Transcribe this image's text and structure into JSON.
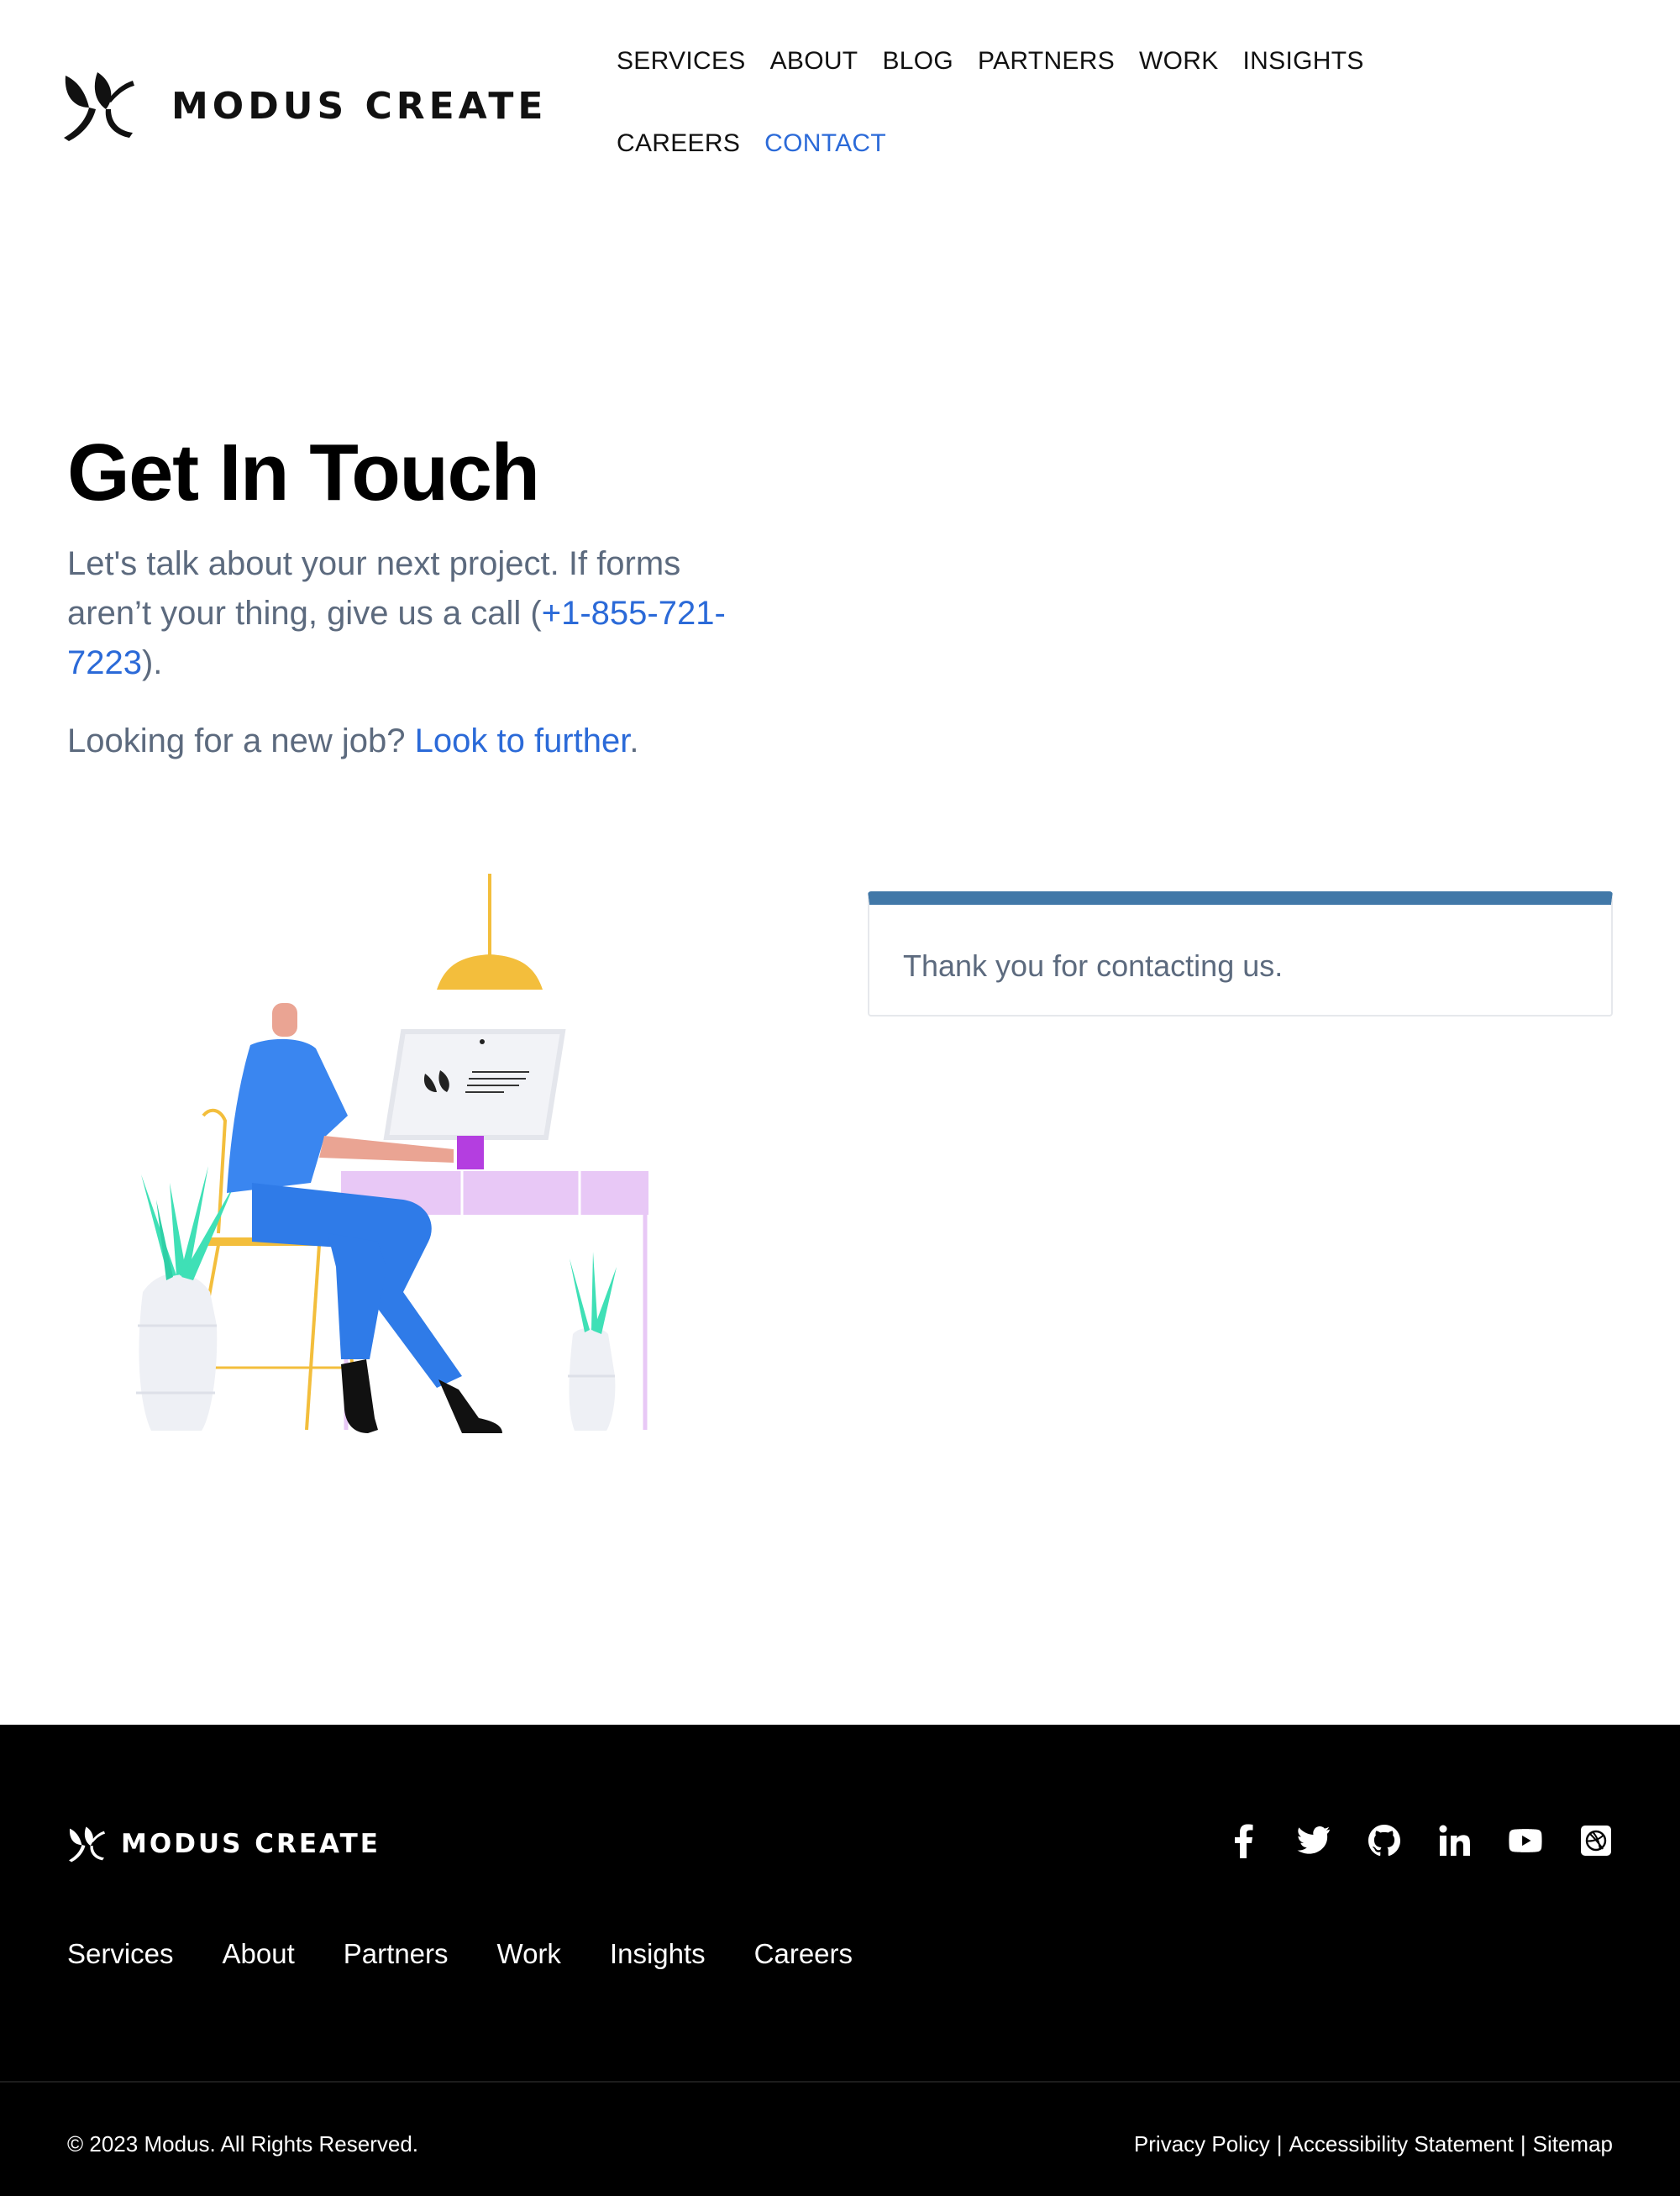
{
  "brand": {
    "name": "MODUS CREATE"
  },
  "nav": {
    "items": [
      {
        "label": "SERVICES"
      },
      {
        "label": "ABOUT"
      },
      {
        "label": "BLOG"
      },
      {
        "label": "PARTNERS"
      },
      {
        "label": "WORK"
      },
      {
        "label": "INSIGHTS"
      },
      {
        "label": "CAREERS"
      },
      {
        "label": "CONTACT",
        "active": true
      }
    ]
  },
  "hero": {
    "title": "Get In Touch",
    "lead_prefix": "Let's talk about your next project. If forms aren’t your thing, give us a call (",
    "phone": "+1-855-721-7223",
    "lead_suffix": ").",
    "job_prefix": "Looking for a new job? ",
    "job_link": "Look to further",
    "job_suffix": "."
  },
  "alert": {
    "message": "Thank you for contacting us."
  },
  "footer": {
    "brand": "MODUS CREATE",
    "social_icons": [
      "facebook-icon",
      "twitter-icon",
      "github-icon",
      "linkedin-icon",
      "youtube-icon",
      "dribbble-icon"
    ],
    "links": [
      {
        "label": "Services"
      },
      {
        "label": "About"
      },
      {
        "label": "Partners"
      },
      {
        "label": "Work"
      },
      {
        "label": "Insights"
      },
      {
        "label": "Careers"
      }
    ],
    "copyright": "© 2023 Modus. All Rights Reserved.",
    "legal": {
      "privacy": "Privacy Policy",
      "accessibility": "Accessibility Statement",
      "sitemap": "Sitemap",
      "separator": "|"
    }
  },
  "colors": {
    "accent": "#2b6ad8",
    "muted_text": "#5c6a7e",
    "alert_bar": "#4178a8",
    "footer_bg": "#000000"
  }
}
